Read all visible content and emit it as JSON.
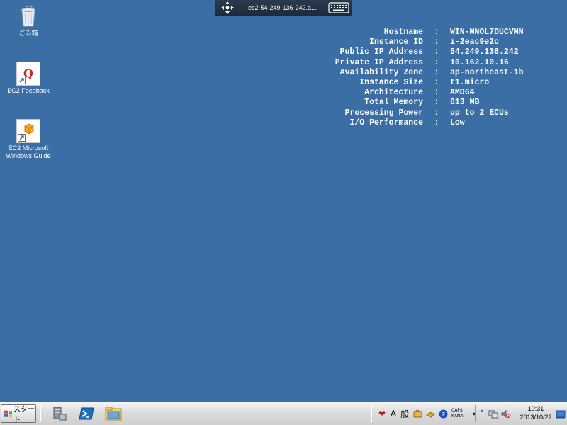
{
  "rdp_bar": {
    "title": "ec2-54-249-136-242.a...",
    "move_icon": "move-arrows-icon",
    "keyboard_icon": "keyboard-icon"
  },
  "desktop_icons": [
    {
      "label": "ごみ箱",
      "icon": "recycle-bin-icon"
    },
    {
      "label": "EC2 Feedback",
      "icon": "feedback-icon"
    },
    {
      "label_line1": "EC2 Microsoft",
      "label_line2": "Windows Guide",
      "icon": "guide-icon"
    }
  ],
  "bginfo": {
    "separator": ":",
    "rows": [
      {
        "label": "Hostname",
        "value": "WIN-MNOL7DUCVMN"
      },
      {
        "label": "Instance ID",
        "value": "i-2eac9e2c"
      },
      {
        "label": "Public IP Address",
        "value": "54.249.136.242"
      },
      {
        "label": "Private IP Address",
        "value": "10.162.10.16"
      },
      {
        "label": "Availability Zone",
        "value": "ap-northeast-1b"
      },
      {
        "label": "Instance Size",
        "value": "t1.micro"
      },
      {
        "label": "Architecture",
        "value": "AMD64"
      },
      {
        "label": "Total Memory",
        "value": "613 MB"
      },
      {
        "label": "Processing Power",
        "value": "up to 2 ECUs"
      },
      {
        "label": "I/O Performance",
        "value": "Low"
      }
    ]
  },
  "taskbar": {
    "start_label": "スタート",
    "pinned": [
      "server-manager-icon",
      "powershell-icon",
      "explorer-icon"
    ],
    "ime": {
      "mode_a": "A",
      "mode_kanji": "般"
    },
    "caps": {
      "line1": "CAPS",
      "line2": "KANA"
    },
    "clock": {
      "time": "10:31",
      "date": "2013/10/22"
    }
  },
  "colors": {
    "desktop_bg": "#3a6ea5",
    "bginfo_text": "#ffffff"
  }
}
